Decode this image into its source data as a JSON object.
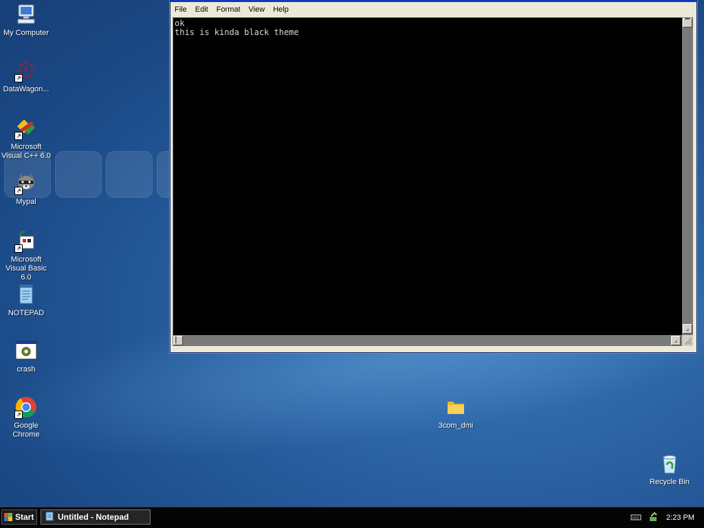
{
  "desktop": {
    "icons": [
      {
        "label": "My Computer",
        "icon": "my-computer-icon"
      },
      {
        "label": "DataWagon...",
        "icon": "datawagon-icon"
      },
      {
        "label": "Microsoft Visual C++ 6.0",
        "icon": "visual-cpp-icon"
      },
      {
        "label": "Mypal",
        "icon": "mypal-raccoon-icon"
      },
      {
        "label": "Microsoft Visual Basic 6.0",
        "icon": "visual-basic-icon"
      },
      {
        "label": "NOTEPAD",
        "icon": "notepad-icon"
      },
      {
        "label": "crash",
        "icon": "crash-app-icon"
      },
      {
        "label": "Google Chrome",
        "icon": "chrome-icon"
      },
      {
        "label": "3com_dmi",
        "icon": "folder-icon"
      },
      {
        "label": "Recycle Bin",
        "icon": "recycle-bin-icon"
      }
    ]
  },
  "notepad": {
    "menu": [
      "File",
      "Edit",
      "Format",
      "View",
      "Help"
    ],
    "content_lines": [
      "ok",
      "this is kinda black theme"
    ]
  },
  "taskbar": {
    "start_label": "Start",
    "task_label": "Untitled - Notepad",
    "clock": "2:23 PM"
  },
  "colors": {
    "desktop_bg": "#2b62a3",
    "editor_bg": "#000000",
    "editor_text": "#d8d8d8",
    "taskbar_bg": "#050505"
  }
}
